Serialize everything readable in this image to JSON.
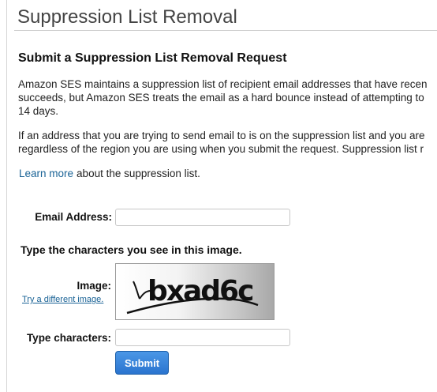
{
  "page": {
    "title": "Suppression List Removal"
  },
  "section": {
    "heading": "Submit a Suppression List Removal Request",
    "paragraph1": [
      "Amazon SES maintains a suppression list of recipient email addresses that have recen",
      "succeeds, but Amazon SES treats the email as a hard bounce instead of attempting to",
      "14 days."
    ],
    "paragraph2": [
      "If an address that you are trying to send email to is on the suppression list and you are",
      "regardless of the region you are using when you submit the request. Suppression list r"
    ],
    "learn_more_link": "Learn more",
    "learn_more_rest": "about the suppression list."
  },
  "form": {
    "email_label": "Email Address:",
    "email_value": "",
    "captcha_prompt": "Type the characters you see in this image.",
    "image_label": "Image:",
    "try_different": "Try a different image.",
    "captcha_text": "bxad6c",
    "type_chars_label": "Type characters:",
    "type_chars_value": "",
    "submit_label": "Submit"
  },
  "colors": {
    "link": "#1a6396",
    "button": "#2a74cf"
  }
}
